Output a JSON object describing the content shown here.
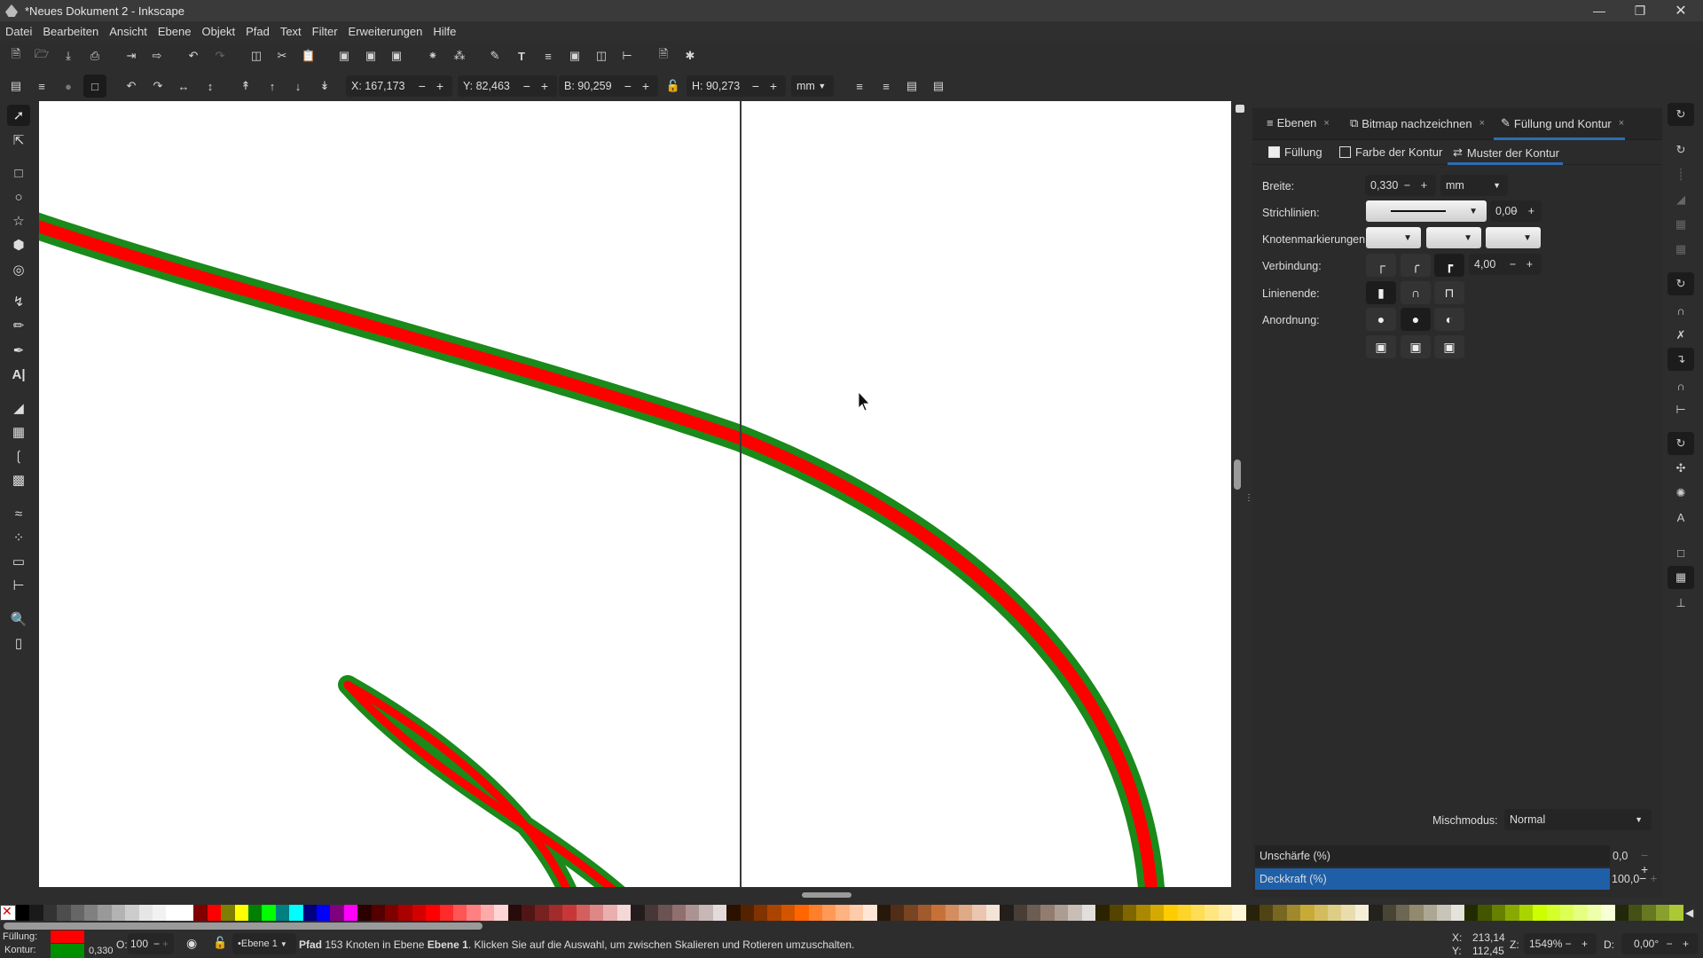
{
  "window": {
    "title": "*Neues Dokument 2 - Inkscape",
    "controls": [
      "minimize",
      "restore",
      "close"
    ]
  },
  "menu": [
    "Datei",
    "Bearbeiten",
    "Ansicht",
    "Ebene",
    "Objekt",
    "Pfad",
    "Text",
    "Filter",
    "Erweiterungen",
    "Hilfe"
  ],
  "controls_bar": {
    "x_label": "X:",
    "x_value": "167,173",
    "y_label": "Y:",
    "y_value": "82,463",
    "w_label": "B:",
    "w_value": "90,259",
    "h_label": "H:",
    "h_value": "90,273",
    "unit": "mm",
    "plusminus": "− +"
  },
  "dock": {
    "tabs": [
      {
        "label": "Ebenen",
        "icon": "layers-icon",
        "close": "×"
      },
      {
        "label": "Bitmap nachzeichnen",
        "icon": "trace-bitmap-icon",
        "close": "×"
      },
      {
        "label": "Füllung und Kontur",
        "icon": "fill-stroke-icon",
        "close": "×",
        "active": true
      }
    ],
    "subtabs": [
      {
        "label": "Füllung",
        "icon": "filled-square-icon"
      },
      {
        "label": "Farbe der Kontur",
        "icon": "empty-square-icon"
      },
      {
        "label": "Muster der Kontur",
        "icon": "stroke-style-icon",
        "active": true
      }
    ],
    "stroke_style": {
      "width_label": "Breite:",
      "width_value": "0,330",
      "width_unit": "mm",
      "dashes_label": "Strichlinien:",
      "dash_offset": "0,00",
      "markers_label": "Knotenmarkierungen:",
      "join_label": "Verbindung:",
      "miter_limit": "4,00",
      "cap_label": "Linienende:",
      "order_label": "Anordnung:"
    },
    "blend_label": "Mischmodus:",
    "blend_value": "Normal",
    "blur_label": "Unschärfe (%)",
    "blur_value": "0,0",
    "opacity_label": "Deckkraft (%)",
    "opacity_value": "100,0"
  },
  "status": {
    "fill_label": "Füllung:",
    "stroke_label": "Kontur:",
    "fill_color": "#ff0000",
    "stroke_color": "#008f00",
    "stroke_width": "0,330",
    "opacity_label": "O:",
    "opacity_value": "100",
    "layer": "•Ebene 1",
    "message_type": "Pfad",
    "message_mid": " 153 Knoten in Ebene ",
    "message_layer": "Ebene 1",
    "message_end": ". Klicken Sie auf die Auswahl, um zwischen Skalieren und Rotieren umzuschalten.",
    "cursor_x_label": "X:",
    "cursor_x": "213,14",
    "cursor_y_label": "Y:",
    "cursor_y": "112,45",
    "zoom_label": "Z:",
    "zoom_value": "1549%",
    "rotate_label": "D:",
    "rotate_value": "0,00°"
  },
  "canvas": {
    "path_fill": "#ff0000",
    "path_stroke": "#1a8a1a",
    "background": "#ffffff"
  },
  "palette": [
    "#000000",
    "#1a1a1a",
    "#333333",
    "#4d4d4d",
    "#666666",
    "#808080",
    "#999999",
    "#b3b3b3",
    "#cccccc",
    "#e6e6e6",
    "#f2f2f2",
    "#ffffff",
    "#ffffff",
    "#800000",
    "#ff0000",
    "#808000",
    "#ffff00",
    "#008000",
    "#00ff00",
    "#008080",
    "#00ffff",
    "#000080",
    "#0000ff",
    "#800080",
    "#ff00ff",
    "#2b0000",
    "#550000",
    "#800000",
    "#aa0000",
    "#d40000",
    "#ff0000",
    "#ff2a2a",
    "#ff5555",
    "#ff8080",
    "#ffaaaa",
    "#ffd5d5",
    "#280b0b",
    "#501616",
    "#782121",
    "#a02c2c",
    "#c83737",
    "#d35f5f",
    "#de8787",
    "#e9afaf",
    "#f4d7d7",
    "#241c1c",
    "#483737",
    "#6c5353",
    "#916f6f",
    "#ac9393",
    "#c8b7b7",
    "#e3dbdb",
    "#2b1100",
    "#552200",
    "#803300",
    "#aa4400",
    "#d45500",
    "#ff6600",
    "#ff7f2a",
    "#ff9955",
    "#ffb380",
    "#ffccaa",
    "#ffe6d5",
    "#28170b",
    "#502d16",
    "#784421",
    "#a05a2c",
    "#c87137",
    "#d38d5f",
    "#deaa87",
    "#e9c6af",
    "#f4e3d7",
    "#241f1c",
    "#483e37",
    "#6c5d53",
    "#917c6f",
    "#ac9d93",
    "#c8beb7",
    "#e3dedb",
    "#2b2200",
    "#554400",
    "#806600",
    "#aa8800",
    "#d4aa00",
    "#ffcc00",
    "#ffd42a",
    "#ffdd55",
    "#ffe680",
    "#ffeeaa",
    "#fff6d5",
    "#28220b",
    "#504416",
    "#786721",
    "#a0892c",
    "#c8ab37",
    "#d3bc5f",
    "#decd87",
    "#e9ddaf",
    "#f4eed7",
    "#24221c",
    "#484537",
    "#6c6753",
    "#918a6f",
    "#aca793",
    "#c8c4b7",
    "#e3e2db",
    "#222b00",
    "#445500",
    "#668000",
    "#88aa00",
    "#aad400",
    "#ccff00",
    "#d4ff2a",
    "#ddff55",
    "#e5ff80",
    "#eeffaa",
    "#f6ffd5",
    "#22280b",
    "#445016",
    "#677821",
    "#89a02c",
    "#abc837"
  ]
}
